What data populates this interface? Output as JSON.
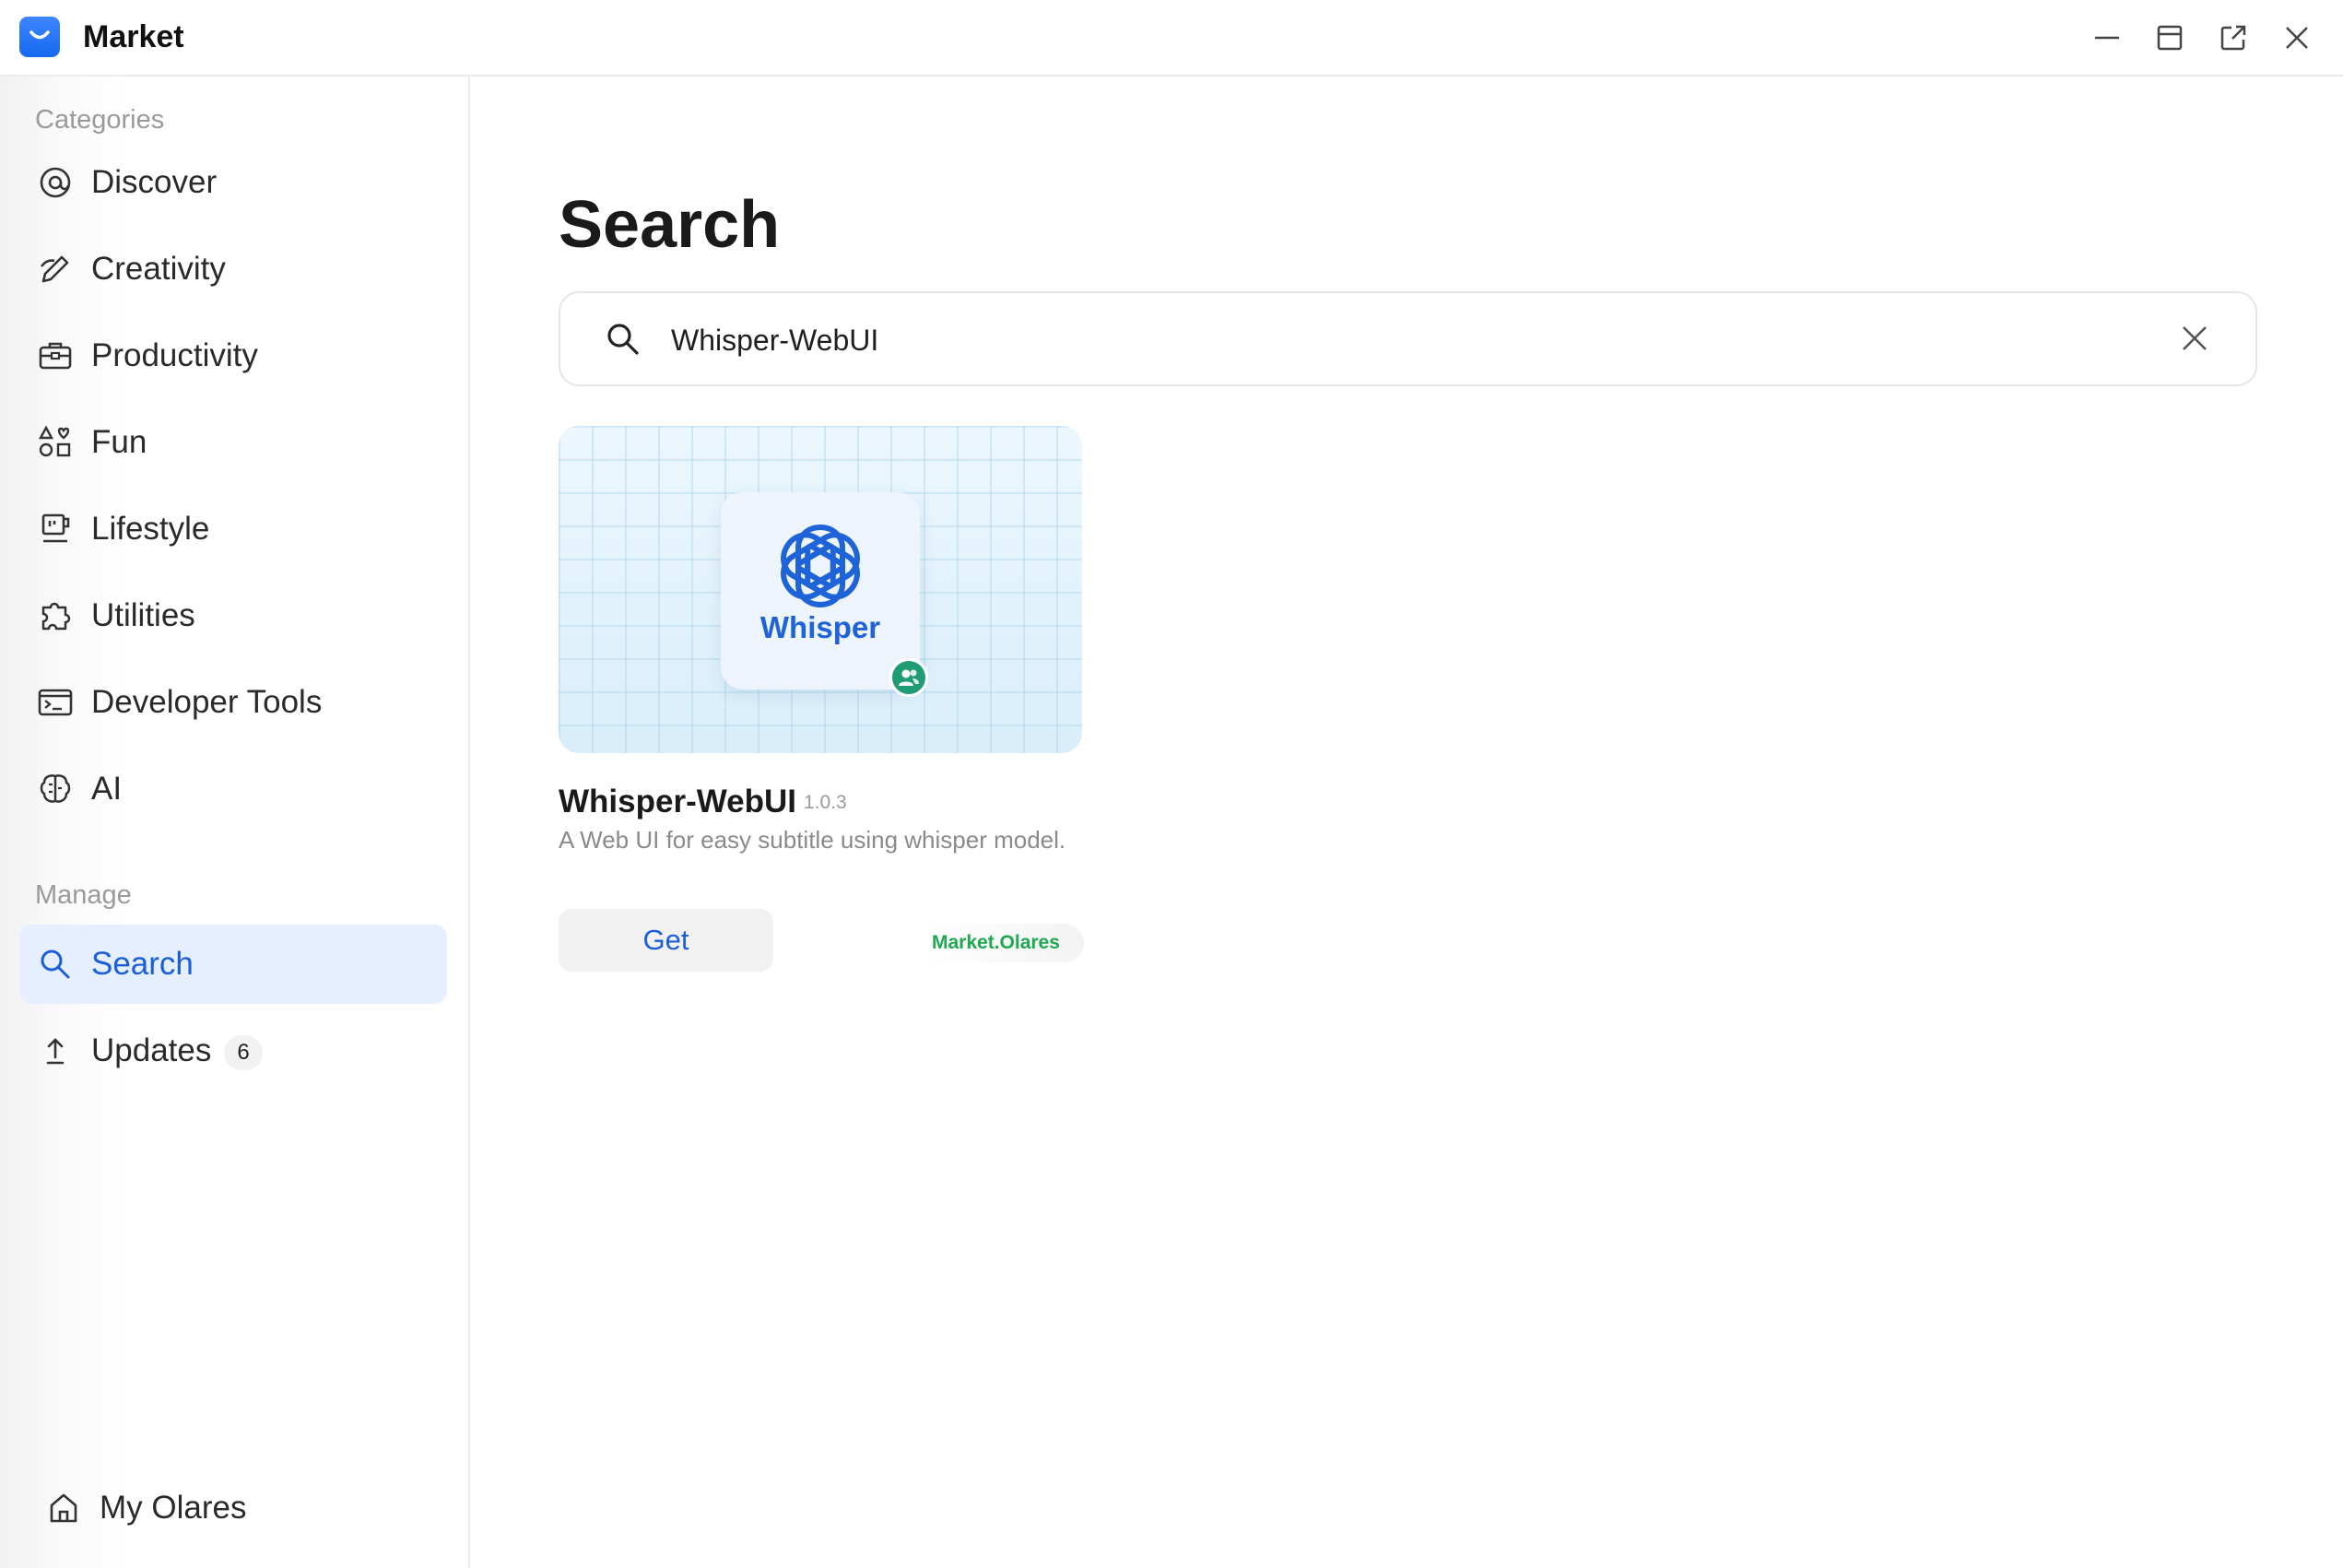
{
  "window": {
    "title": "Market",
    "controls": [
      "minimize-icon",
      "restore-icon",
      "open-external-icon",
      "close-icon"
    ]
  },
  "sidebar": {
    "categories_label": "Categories",
    "categories": [
      {
        "label": "Discover",
        "icon": "at-sign-icon"
      },
      {
        "label": "Creativity",
        "icon": "pen-icon"
      },
      {
        "label": "Productivity",
        "icon": "briefcase-icon"
      },
      {
        "label": "Fun",
        "icon": "shapes-icon"
      },
      {
        "label": "Lifestyle",
        "icon": "coffee-icon"
      },
      {
        "label": "Utilities",
        "icon": "puzzle-icon"
      },
      {
        "label": "Developer Tools",
        "icon": "terminal-icon"
      },
      {
        "label": "AI",
        "icon": "brain-icon"
      }
    ],
    "manage_label": "Manage",
    "manage": [
      {
        "label": "Search",
        "icon": "search-icon",
        "active": true
      },
      {
        "label": "Updates",
        "icon": "upload-icon",
        "badge": "6"
      }
    ],
    "footer": {
      "label": "My Olares",
      "icon": "home-icon"
    }
  },
  "main": {
    "title": "Search",
    "search": {
      "value": "Whisper-WebUI"
    },
    "results": [
      {
        "tile_text": "Whisper",
        "name": "Whisper-WebUI",
        "version": "1.0.3",
        "description": "A Web UI for easy subtitle using whisper model.",
        "action": "Get",
        "source": "Market.Olares"
      }
    ]
  },
  "colors": {
    "accent": "#1a5fd9",
    "active_bg": "#e6efff",
    "source_green": "#1fa84f",
    "shared_badge": "#1f9c73"
  }
}
